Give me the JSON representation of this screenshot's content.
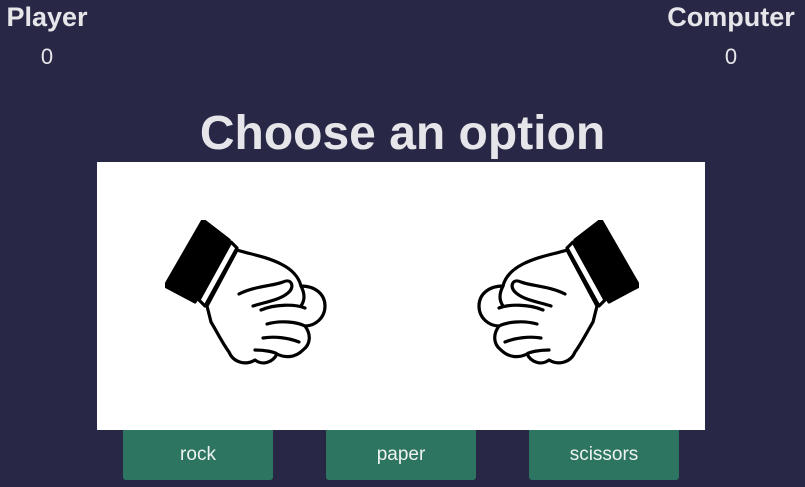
{
  "scoreboard": {
    "player": {
      "label": "Player",
      "score": "0"
    },
    "computer": {
      "label": "Computer",
      "score": "0"
    }
  },
  "title": "Choose an option",
  "hands": {
    "left": "rock-fist-icon",
    "right": "rock-fist-icon"
  },
  "buttons": {
    "rock": "rock",
    "paper": "paper",
    "scissors": "scissors"
  },
  "colors": {
    "background": "#282846",
    "stage": "#ffffff",
    "button": "#2d7561",
    "text": "#e6e6ea"
  }
}
